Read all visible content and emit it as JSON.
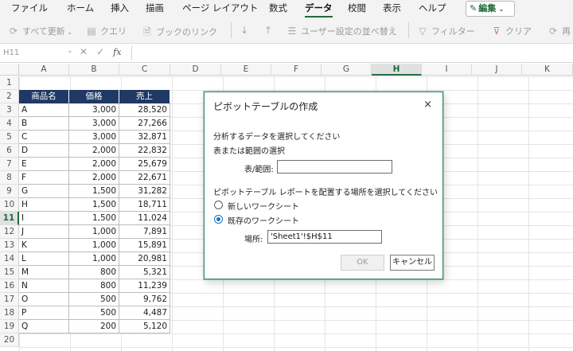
{
  "ribbon": {
    "tabs": [
      "ファイル",
      "ホーム",
      "挿入",
      "描画",
      "ページ レイアウト",
      "数式",
      "データ",
      "校閲",
      "表示",
      "ヘルプ"
    ],
    "active_tab": "データ",
    "edit_button": "編集"
  },
  "toolbar": {
    "refresh_all": "すべて更新",
    "queries": "クエリ",
    "workbook_links": "ブックのリンク",
    "custom_sort": "ユーザー設定の並べ替え",
    "filter": "フィルター",
    "clear": "クリア",
    "reapply": "再"
  },
  "formula_bar": {
    "name_box": "H11",
    "fx": "fx"
  },
  "grid": {
    "columns": [
      "A",
      "B",
      "C",
      "D",
      "E",
      "F",
      "G",
      "H",
      "I",
      "J",
      "K"
    ],
    "selected_column": "H",
    "rows": [
      "1",
      "2",
      "3",
      "4",
      "5",
      "6",
      "7",
      "8",
      "9",
      "10",
      "11",
      "12",
      "13",
      "14",
      "15",
      "16",
      "17",
      "18",
      "19",
      "20"
    ],
    "selected_row": "11"
  },
  "table": {
    "headers": [
      "商品名",
      "価格",
      "売上"
    ],
    "rows": [
      [
        "A",
        "3,000",
        "28,520"
      ],
      [
        "B",
        "3,000",
        "27,266"
      ],
      [
        "C",
        "3,000",
        "32,871"
      ],
      [
        "D",
        "2,000",
        "22,832"
      ],
      [
        "E",
        "2,000",
        "25,679"
      ],
      [
        "F",
        "2,000",
        "22,671"
      ],
      [
        "G",
        "1,500",
        "31,282"
      ],
      [
        "H",
        "1,500",
        "18,711"
      ],
      [
        "I",
        "1,500",
        "11,024"
      ],
      [
        "J",
        "1,000",
        "7,891"
      ],
      [
        "K",
        "1,000",
        "15,891"
      ],
      [
        "L",
        "1,000",
        "20,981"
      ],
      [
        "M",
        "800",
        "5,321"
      ],
      [
        "N",
        "800",
        "11,239"
      ],
      [
        "O",
        "500",
        "9,762"
      ],
      [
        "P",
        "500",
        "4,487"
      ],
      [
        "Q",
        "200",
        "5,120"
      ]
    ],
    "header_color": "#203864"
  },
  "dialog": {
    "title": "ピボットテーブルの作成",
    "close": "×",
    "select_data_prompt": "分析するデータを選択してください",
    "select_range_label": "表または範囲の選択",
    "table_range_label": "表/範囲:",
    "table_range_value": "",
    "placement_prompt": "ピボットテーブル レポートを配置する場所を選択してください",
    "option_new_sheet": "新しいワークシート",
    "option_existing_sheet": "既存のワークシート",
    "selected_option": "existing",
    "location_label": "場所:",
    "location_value": "'Sheet1'!$H$11",
    "ok_label": "OK",
    "cancel_label": "キャンセル",
    "accent_color": "#2f8f5a"
  }
}
